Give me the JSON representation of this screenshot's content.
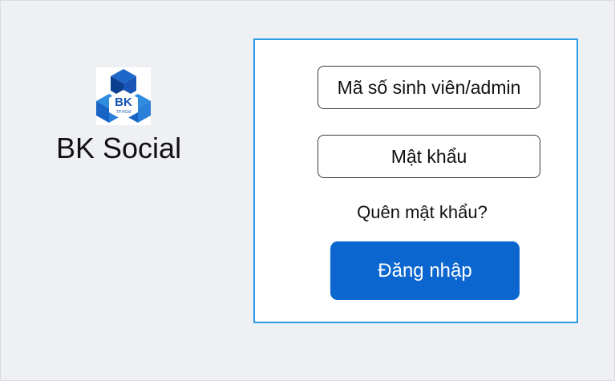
{
  "brand": {
    "logo_text": "BK",
    "logo_subtext": "TP.HCM",
    "name": "BK Social"
  },
  "login": {
    "username_placeholder": "Mã số sinh viên/admin",
    "password_placeholder": "Mật khẩu",
    "forgot_password": "Quên mật khẩu?",
    "submit_label": "Đăng nhập"
  },
  "colors": {
    "accent": "#0b67cf",
    "panel_border": "#2b9be6",
    "background": "#eef0f4"
  }
}
